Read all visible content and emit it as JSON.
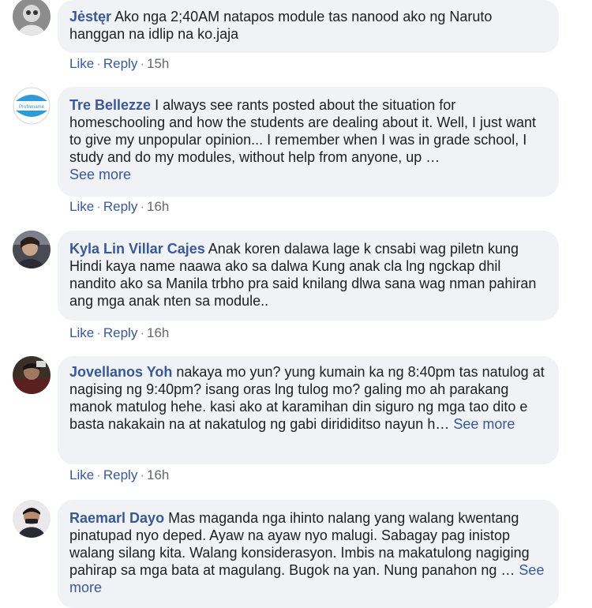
{
  "actions": {
    "like_label": "Like",
    "reply_label": "Reply",
    "separator": "·"
  },
  "comments": [
    {
      "author": "Jėstęr",
      "text": "Ako nga 2;40AM natapos module tas nanood ako ng Naruto hanggan na idlip na ko.jaja",
      "see_more": "",
      "time": "15h"
    },
    {
      "author": "Tre Bellezze",
      "text": "I always see rants posted about the situation for homeschooling and how the students are dealing about it. Well, I just want to give my unpopular opinion... I remember when I was in grade school, I study and do my modules, without help from anyone, up …",
      "see_more": "See more",
      "time": "16h",
      "avatar_text": "Profilename"
    },
    {
      "author": "Kyla Lin Villar Cajes",
      "text": "Anak koren dalawa lage k cnsabi wag piletn kung Hindi kaya name naawa ako sa dalwa Kung anak cla lng ngckap dhil nandito ako sa Manila trbho pra said knilang dlwa sana wag nman pahiran ang mga anak nten sa module..",
      "see_more": "",
      "time": "16h"
    },
    {
      "author": "Jovellanos Yoh",
      "text": "nakaya mo yun? yung kumain ka ng 8:40pm tas natulog at nagising ng 9:40pm? isang oras lng tulog mo? galing mo ah parakang manok matulog hehe. kasi ako at karamihan din siguro ng mga tao dito e basta nakakain na at nakatulog ng gabi dirididitso nayun h…",
      "see_more": "See more",
      "time": "16h"
    },
    {
      "author": "Raemarl Dayo",
      "text": "Mas maganda nga ihinto nalang yang walang kwentang pinatupad nyo deped. Ayaw na ayaw nyo malugi. Sabagay pag inistop walang silang kita. Walang konsiderasyon. Imbis na makatulong nagiging pahirap sa mga bata at magulang. Bugok na yan. Nung panahon ng …",
      "see_more": "See more",
      "time": ""
    }
  ]
}
